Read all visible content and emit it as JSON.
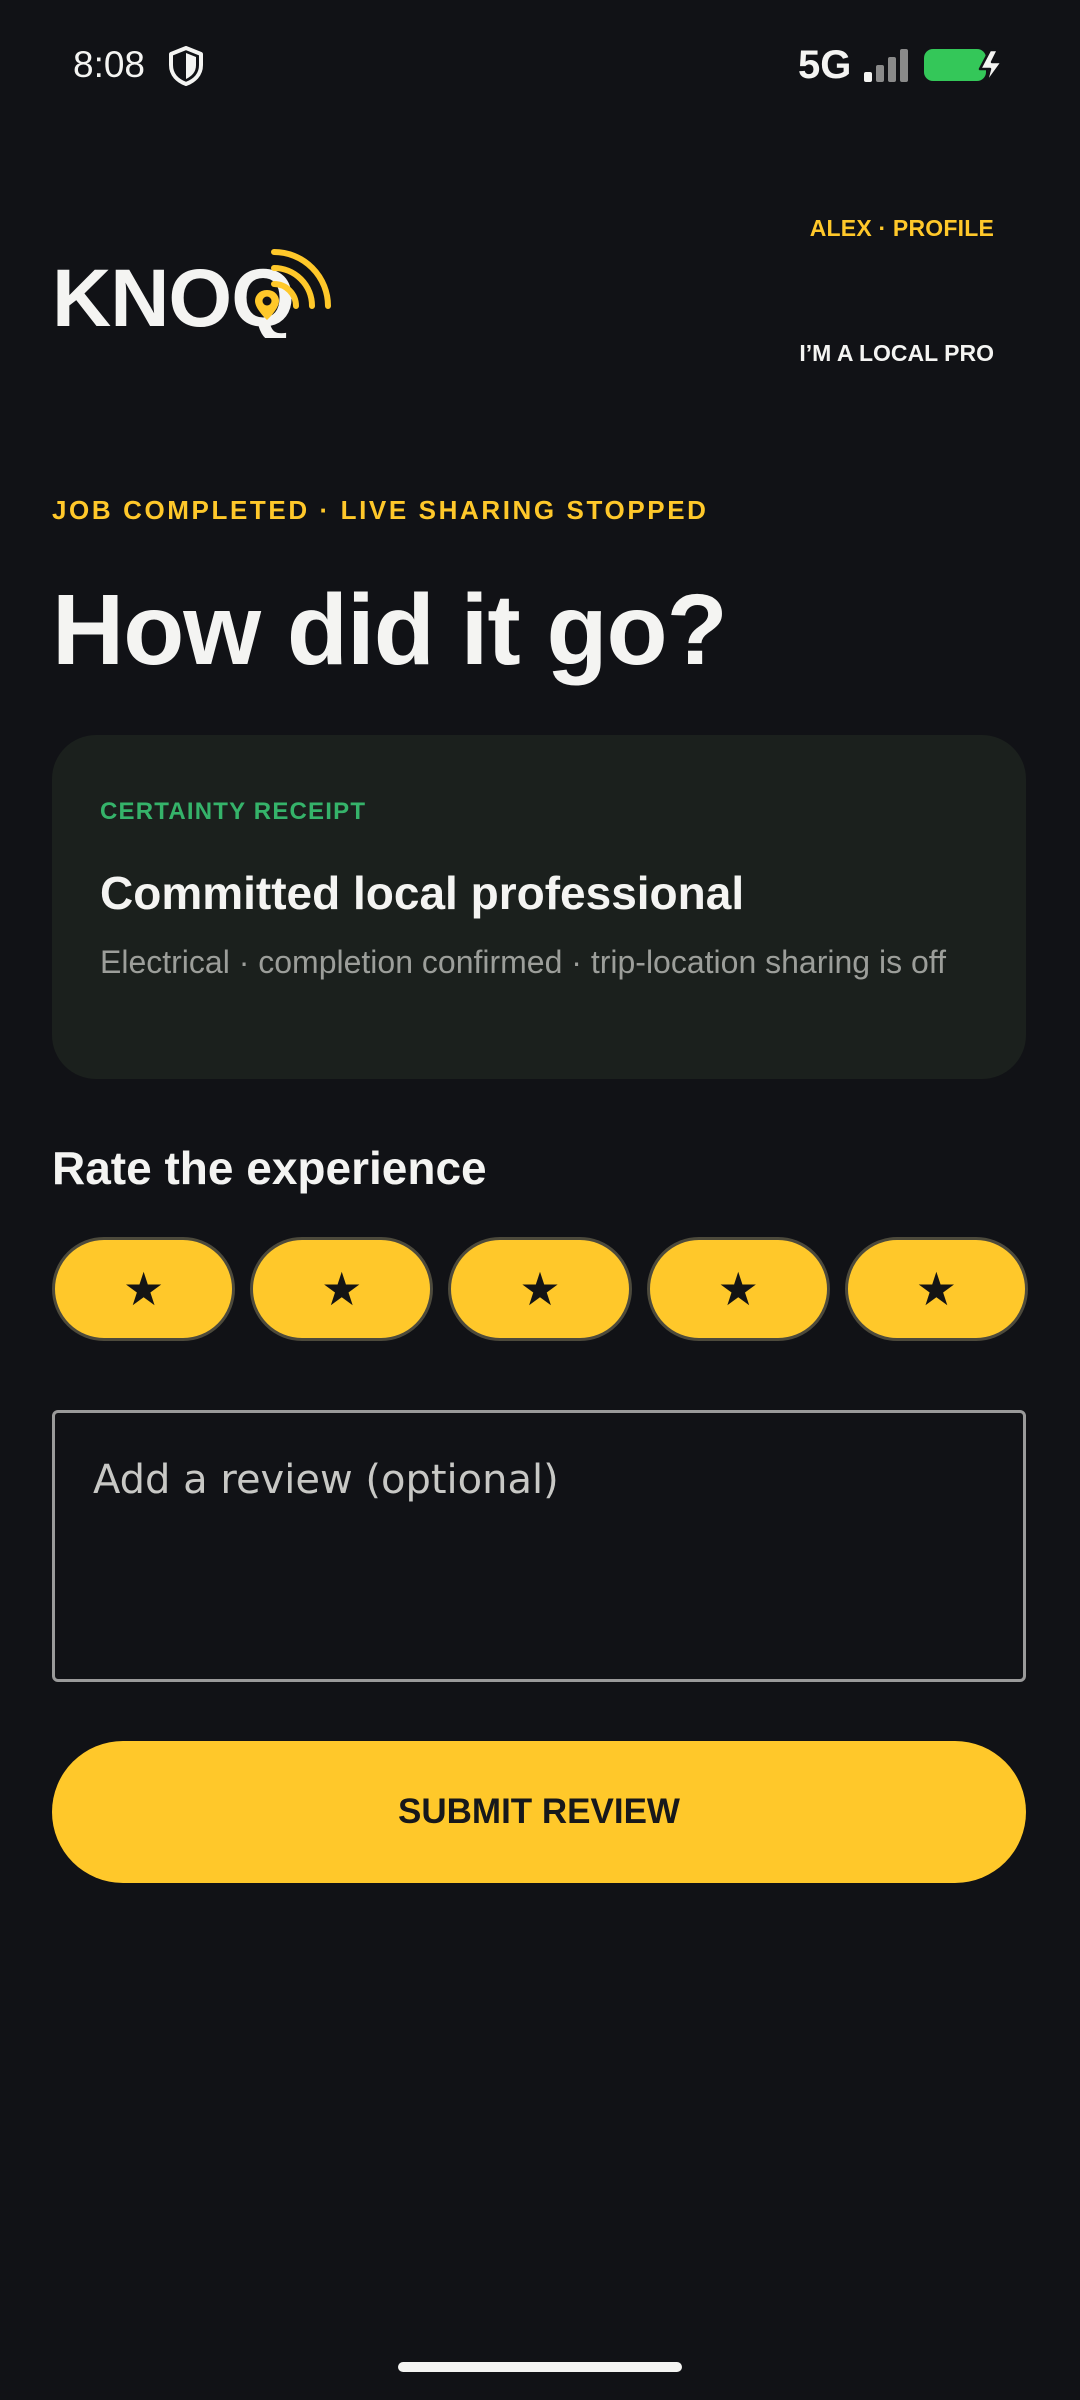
{
  "status_bar": {
    "time": "8:08",
    "network": "5G",
    "battery_color": "#34c759"
  },
  "header": {
    "logo_text": "KNOQ",
    "profile_link": "ALEX · PROFILE",
    "pro_link": "I’M A LOCAL PRO"
  },
  "main": {
    "eyebrow": "JOB COMPLETED · LIVE SHARING STOPPED",
    "title": "How did it go?",
    "receipt": {
      "label": "CERTAINTY RECEIPT",
      "title": "Committed local professional",
      "detail": "Electrical · completion confirmed · trip-location sharing is off"
    },
    "rating": {
      "label": "Rate the experience",
      "stars": [
        "★",
        "★",
        "★",
        "★",
        "★"
      ],
      "value": 5,
      "max": 5
    },
    "review": {
      "placeholder": "Add a review (optional)",
      "value": ""
    },
    "submit_label": "SUBMIT REVIEW"
  },
  "colors": {
    "background": "#111216",
    "accent": "#ffc82a",
    "success": "#35b36a",
    "card": "#1b201d",
    "text": "#f4f4f2"
  }
}
